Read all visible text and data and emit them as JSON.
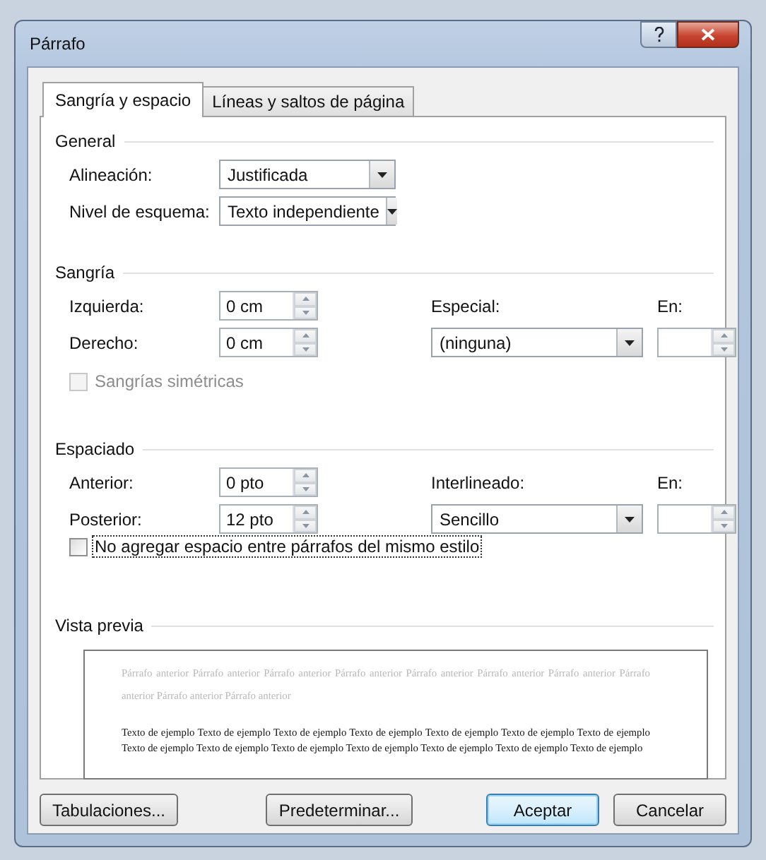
{
  "window": {
    "title": "Párrafo"
  },
  "tabs": [
    {
      "label": "Sangría y espacio",
      "selected": true
    },
    {
      "label": "Líneas y saltos de página",
      "selected": false
    }
  ],
  "general": {
    "title": "General",
    "alignment": {
      "label": "Alineación:",
      "value": "Justificada"
    },
    "outline_level": {
      "label": "Nivel de esquema:",
      "value": "Texto independiente"
    }
  },
  "indentation": {
    "title": "Sangría",
    "left": {
      "label": "Izquierda:",
      "value": "0 cm"
    },
    "right": {
      "label": "Derecho:",
      "value": "0 cm"
    },
    "special": {
      "label": "Especial:",
      "value": "(ninguna)"
    },
    "by": {
      "label": "En:"
    },
    "mirror": {
      "label": "Sangrías simétricas",
      "checked": false,
      "disabled": true
    }
  },
  "spacing": {
    "title": "Espaciado",
    "before": {
      "label": "Anterior:",
      "value": "0 pto"
    },
    "after": {
      "label": "Posterior:",
      "value": "12 pto"
    },
    "line_spacing": {
      "label": "Interlineado:",
      "value": "Sencillo"
    },
    "at": {
      "label": "En:"
    },
    "no_space": {
      "label": "No agregar espacio entre párrafos del mismo estilo",
      "checked": false,
      "disabled": false
    }
  },
  "preview": {
    "title": "Vista previa",
    "previous": "Párrafo anterior Párrafo anterior Párrafo anterior Párrafo anterior Párrafo anterior Párrafo anterior Párrafo anterior Párrafo anterior Párrafo anterior Párrafo anterior",
    "sample": "Texto de ejemplo Texto de ejemplo Texto de ejemplo Texto de ejemplo Texto de ejemplo Texto de ejemplo Texto de ejemplo Texto de ejemplo Texto de ejemplo Texto de ejemplo Texto de ejemplo Texto de ejemplo Texto de ejemplo Texto de ejemplo"
  },
  "buttons": [
    {
      "label": "Tabulaciones...",
      "kind": "normal"
    },
    {
      "label": "Predeterminar...",
      "kind": "normal"
    },
    {
      "label": "Aceptar",
      "kind": "default"
    },
    {
      "label": "Cancelar",
      "kind": "normal"
    }
  ]
}
